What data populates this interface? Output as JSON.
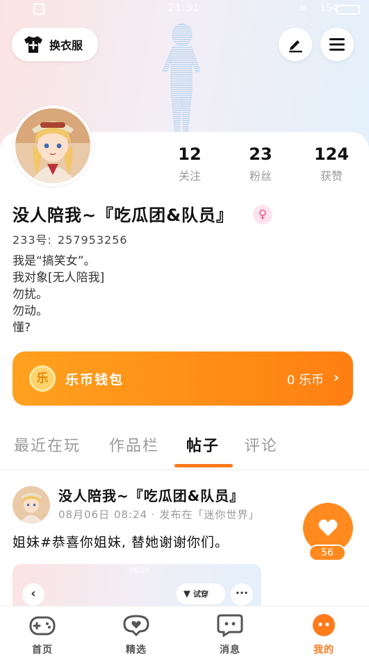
{
  "status_bar": {
    "time": "21:51",
    "battery": "154"
  },
  "header": {
    "outfit_button": "换衣服",
    "edit_icon": "pencil-icon",
    "menu_icon": "hamburger-menu-icon"
  },
  "profile": {
    "stats": [
      {
        "num": "12",
        "label": "关注"
      },
      {
        "num": "23",
        "label": "粉丝"
      },
      {
        "num": "124",
        "label": "获赞"
      }
    ],
    "username": "没人陪我~『吃瓜团&队员』",
    "gender": "♀",
    "uid_label": "233号:",
    "uid_value": "257953256",
    "bio": [
      "我是“搞笑女”。",
      "我对象[无人陪我]",
      "勿扰。",
      "勿动。",
      "懂?"
    ]
  },
  "wallet": {
    "coin_char": "乐",
    "title": "乐币钱包",
    "balance": "0 乐币"
  },
  "tabs": [
    "最近在玩",
    "作品栏",
    "帖子",
    "评论"
  ],
  "active_tab": "帖子",
  "post": {
    "author": "没人陪我~『吃瓜团&队员』",
    "meta": "08月06日 08:24 · 发布在「迷你世界」",
    "text": "姐妹#恭喜你姐妹, 替她谢谢你们。",
    "thumb_time": "08:20",
    "thumb_try_label": "试穿",
    "likes": "56"
  },
  "nav": [
    {
      "label": "首页",
      "icon": "gamepad-icon"
    },
    {
      "label": "精选",
      "icon": "heart-chat-icon"
    },
    {
      "label": "消息",
      "icon": "message-icon"
    },
    {
      "label": "我的",
      "icon": "profile-face-icon"
    }
  ],
  "colors": {
    "accent": "#ff7b1c",
    "wallet_start": "#ffa11e",
    "wallet_end": "#ff7f12",
    "gender_pink": "#f0508e"
  }
}
